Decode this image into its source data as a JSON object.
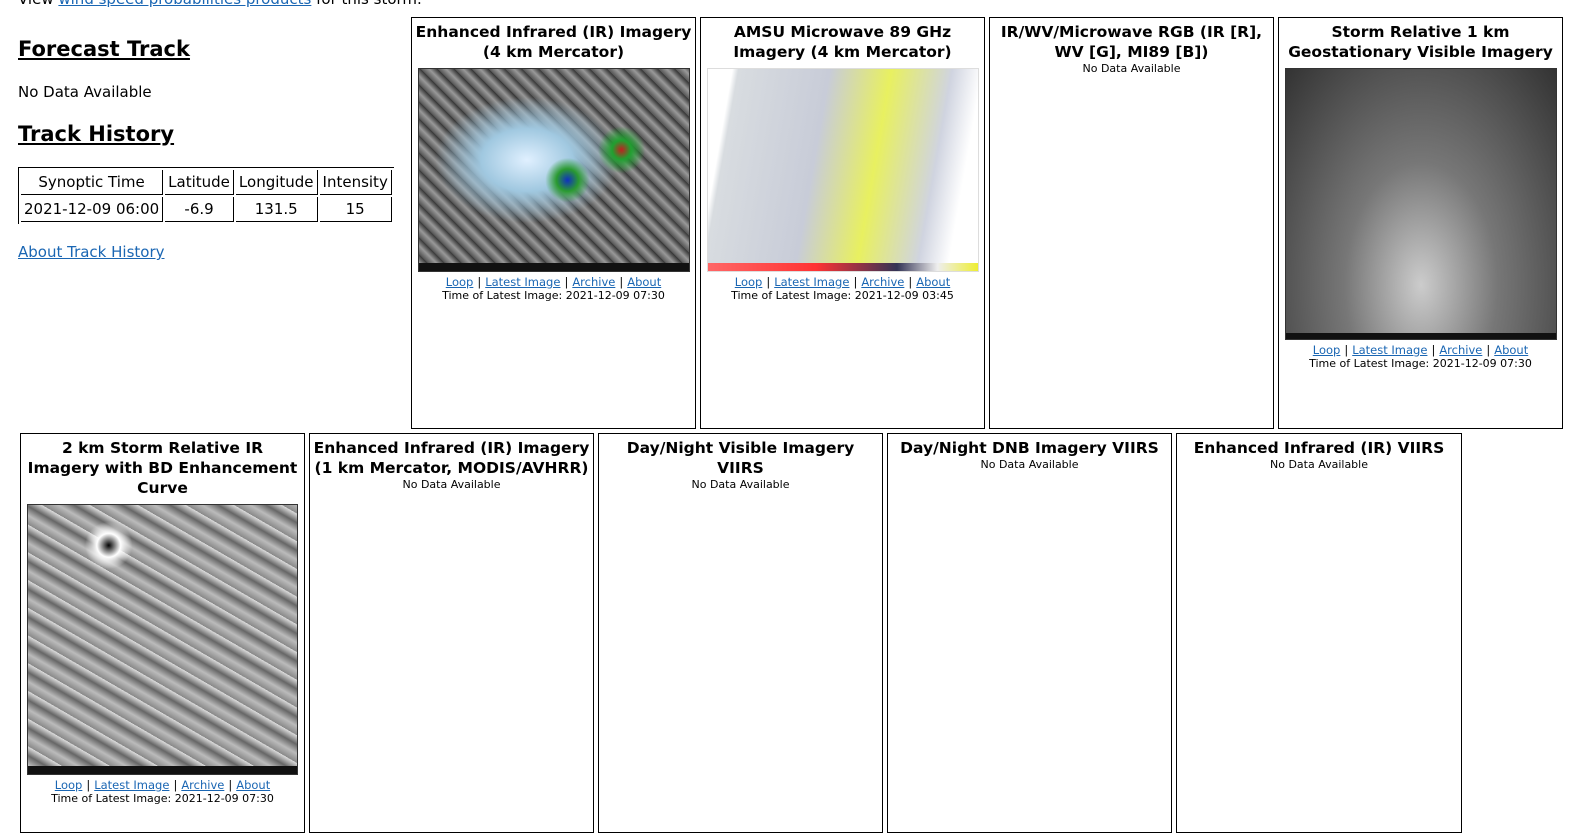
{
  "top_line": {
    "prefix": "View ",
    "link": "wind speed probabilities products",
    "suffix": " for this storm."
  },
  "forecast_track": {
    "heading": "Forecast Track",
    "status": "No Data Available"
  },
  "track_history": {
    "heading": "Track History",
    "columns": [
      "Synoptic Time",
      "Latitude",
      "Longitude",
      "Intensity"
    ],
    "rows": [
      [
        "2021-12-09 06:00",
        "-6.9",
        "131.5",
        "15"
      ]
    ],
    "about_link": "About Track History"
  },
  "links": {
    "loop": "Loop",
    "latest": "Latest Image",
    "archive": "Archive",
    "about": "About",
    "sep": "|"
  },
  "panels": [
    {
      "title": "Enhanced Infrared (IR) Imagery (4 km Mercator)",
      "time": "Time of Latest Image: 2021-12-09 07:30"
    },
    {
      "title": "AMSU Microwave 89 GHz Imagery (4 km Mercator)",
      "time": "Time of Latest Image: 2021-12-09 03:45"
    },
    {
      "title": "IR/WV/Microwave RGB (IR [R], WV [G], MI89 [B])",
      "status": "No Data Available"
    },
    {
      "title": "Storm Relative 1 km Geostationary Visible Imagery",
      "time": "Time of Latest Image: 2021-12-09 07:30"
    },
    {
      "title": "2 km Storm Relative IR Imagery with BD Enhancement Curve",
      "time": "Time of Latest Image: 2021-12-09 07:30"
    },
    {
      "title": "Enhanced Infrared (IR) Imagery (1 km Mercator, MODIS/AVHRR)",
      "status": "No Data Available"
    },
    {
      "title": "Day/Night Visible Imagery VIIRS",
      "status": "No Data Available"
    },
    {
      "title": "Day/Night DNB Imagery VIIRS",
      "status": "No Data Available"
    },
    {
      "title": "Enhanced Infrared (IR) VIIRS",
      "status": "No Data Available"
    }
  ]
}
